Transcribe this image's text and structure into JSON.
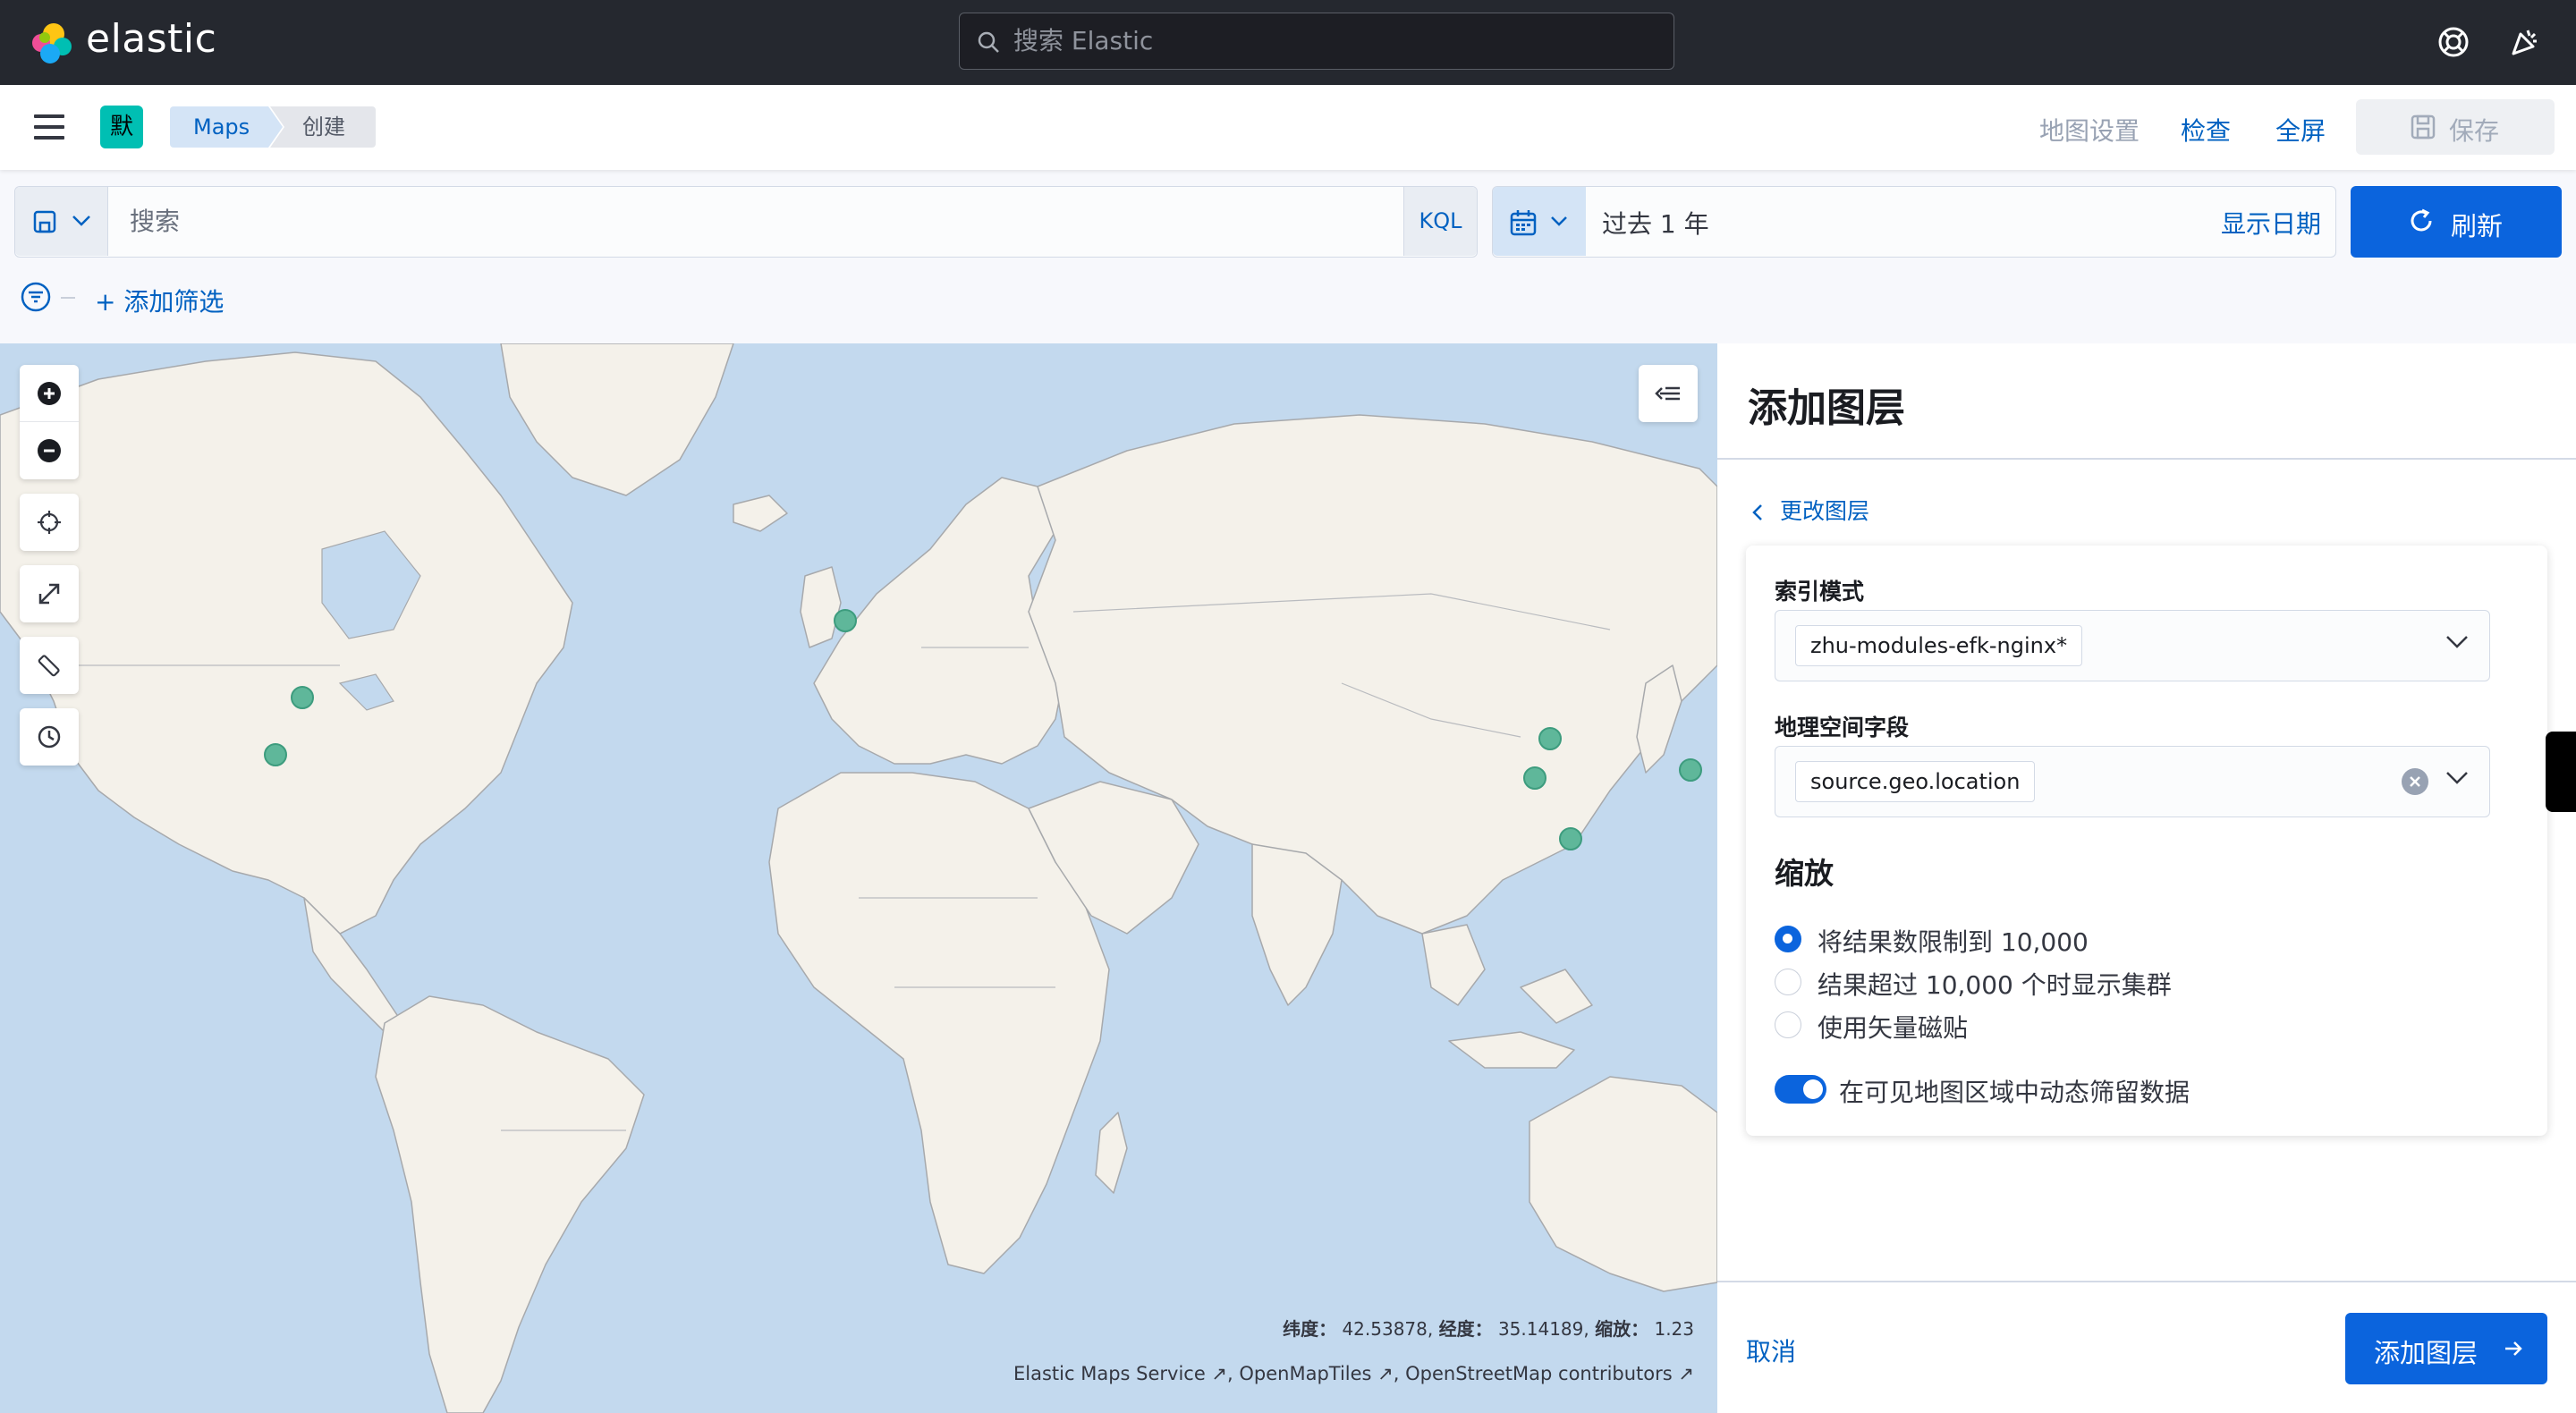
{
  "header": {
    "brand": "elastic",
    "search_placeholder": "搜索 Elastic",
    "icons": [
      "help-icon",
      "newsfeed-icon"
    ]
  },
  "appbar": {
    "space_initial": "默",
    "breadcrumbs": [
      "Maps",
      "创建"
    ],
    "links": {
      "map_settings": "地图设置",
      "inspect": "检查",
      "fullscreen": "全屏",
      "save": "保存"
    }
  },
  "query": {
    "placeholder": "搜索",
    "language": "KQL",
    "time_range": "过去 1 年",
    "show_dates": "显示日期",
    "refresh": "刷新",
    "add_filter": "+ 添加筛选"
  },
  "map": {
    "coords": {
      "lat_label": "纬度：",
      "lat": "42.53878,",
      "lon_label": "经度：",
      "lon": "35.14189,",
      "zoom_label": "缩放：",
      "zoom": "1.23"
    },
    "attribution": [
      "Elastic Maps Service",
      "OpenMapTiles",
      "OpenStreetMap contributors"
    ],
    "colors": {
      "water": "#c3d9ee",
      "land": "#f4f1ea",
      "point": "#5fb79a"
    }
  },
  "panel": {
    "title": "添加图层",
    "back_link": "更改图层",
    "index_pattern_label": "索引模式",
    "index_pattern_value": "zhu-modules-efk-nginx*",
    "geo_field_label": "地理空间字段",
    "geo_field_value": "source.geo.location",
    "scaling_title": "缩放",
    "scaling_options": [
      {
        "label": "将结果数限制到 10,000",
        "selected": true
      },
      {
        "label": "结果超过 10,000 个时显示集群",
        "selected": false
      },
      {
        "label": "使用矢量磁贴",
        "selected": false
      }
    ],
    "dynamic_filter_label": "在可见地图区域中动态筛留数据",
    "dynamic_filter_on": true,
    "cancel": "取消",
    "add_layer": "添加图层"
  }
}
